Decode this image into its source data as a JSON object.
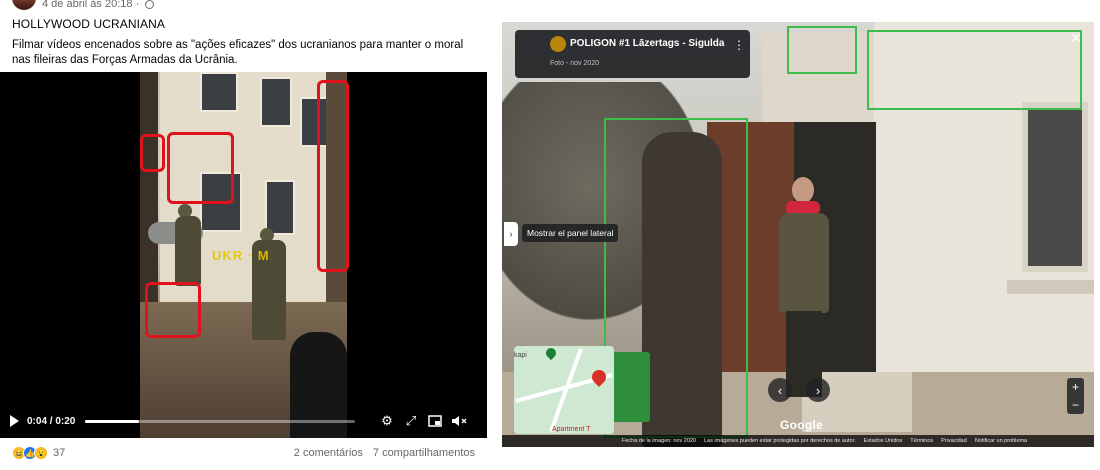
{
  "post": {
    "timestamp": "4 de abril às 20:18 ·",
    "title": "HOLLYWOOD UCRANIANA",
    "text": "Filmar vídeos encenados sobre as \"ações eficazes\" dos ucranianos para manter o moral nas fileiras das Forças Armadas da Ucrânia.",
    "video": {
      "watermark": "UKR · M",
      "time": "0:04 / 0:20",
      "progress": 0.2
    },
    "footer": {
      "reaction_count": "37",
      "comments": "2 comentários",
      "shares": "7 compartilhamentos"
    },
    "highlight_color": "#e0121b"
  },
  "streetview": {
    "place": "POLIGON #1 Lāzertags - Sigulda",
    "date": "Foto - nov 2020",
    "panel_tooltip": "Mostrar el panel lateral",
    "minimap_label_top": "kapi",
    "minimap_label_bottom": "Apartment T",
    "google": "Google",
    "zoom_in": "+",
    "zoom_out": "−",
    "bottom_bar": {
      "image_date": "Fecha de la imagen: nov 2020",
      "copyright": "Las imágenes pueden estar protegidas por derechos de autor.",
      "country": "Estados Unidos",
      "terms": "Términos",
      "privacy": "Privacidad",
      "report": "Notificar un problema"
    },
    "highlight_color": "#3dbb4b"
  },
  "icons": {
    "globe": "globe-icon",
    "play": "play-icon",
    "settings": "gear-icon",
    "fullscreen": "expand-icon",
    "pip": "picture-in-picture-icon",
    "mute": "speaker-muted-icon",
    "more": "more-vertical-icon",
    "close": "close-icon",
    "prev": "chevron-left-icon",
    "next": "chevron-right-icon"
  }
}
